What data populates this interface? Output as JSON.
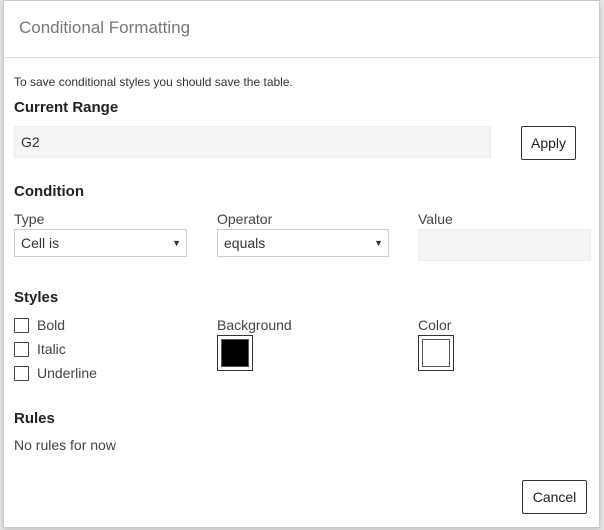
{
  "dialog": {
    "title": "Conditional Formatting",
    "note": "To save conditional styles you should save the table."
  },
  "range": {
    "title": "Current Range",
    "value": "G2",
    "apply_label": "Apply"
  },
  "condition": {
    "title": "Condition",
    "type_label": "Type",
    "type_value": "Cell is",
    "operator_label": "Operator",
    "operator_value": "equals",
    "value_label": "Value",
    "value_value": "",
    "dropdown_glyph": "▼"
  },
  "styles": {
    "title": "Styles",
    "bold_label": "Bold",
    "italic_label": "Italic",
    "underline_label": "Underline",
    "background_label": "Background",
    "background_color": "#000000",
    "color_label": "Color",
    "text_color": "#ffffff"
  },
  "rules": {
    "title": "Rules",
    "empty_text": "No rules for now"
  },
  "footer": {
    "cancel_label": "Cancel"
  }
}
